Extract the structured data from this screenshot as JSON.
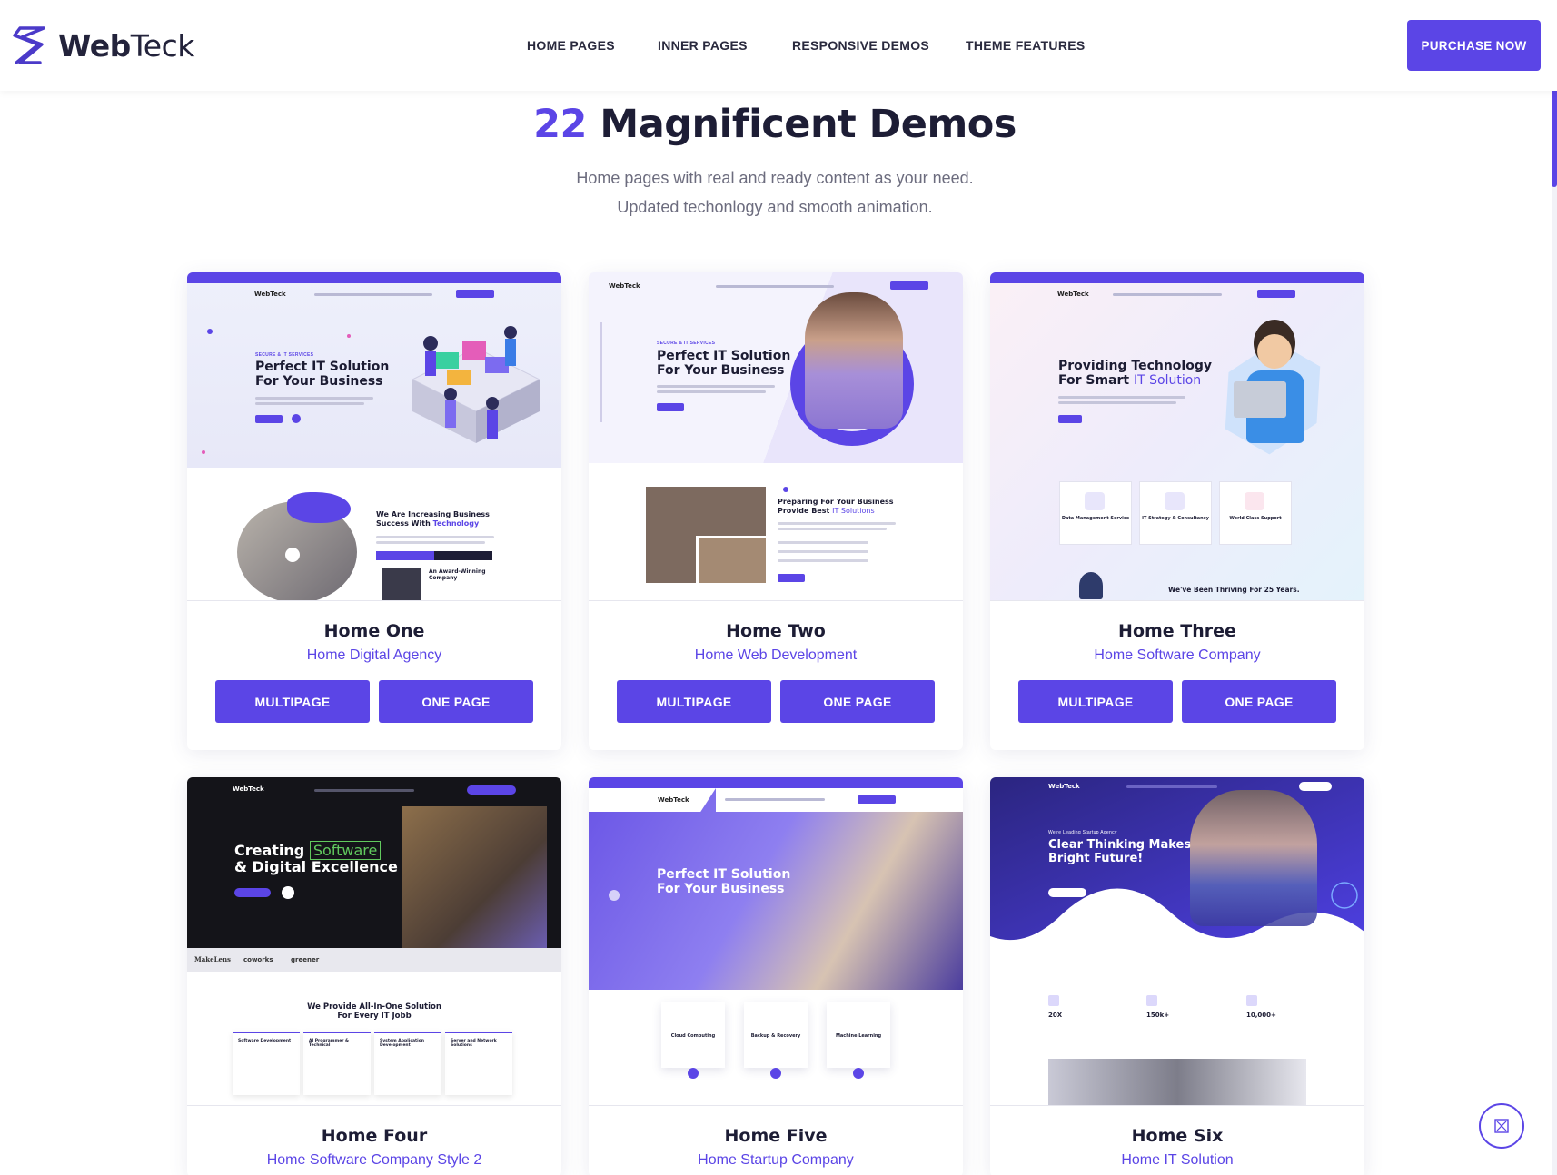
{
  "brand": {
    "name_bold": "Web",
    "name_regular": "Teck"
  },
  "nav": {
    "items": [
      "HOME PAGES",
      "INNER PAGES",
      "RESPONSIVE DEMOS",
      "THEME FEATURES"
    ],
    "purchase_label": "PURCHASE NOW"
  },
  "hero": {
    "count": "22",
    "title": "Magnificent Demos",
    "line1": "Home pages with real and ready content as your need.",
    "line2": "Updated techonlogy and smooth animation."
  },
  "colors": {
    "accent": "#5b45e6",
    "heading": "#1d1d35",
    "muted": "#6c6c7e"
  },
  "demos": [
    {
      "title": "Home One",
      "subtitle": "Home Digital Agency",
      "buttons": [
        "MULTIPAGE",
        "ONE PAGE"
      ],
      "preview": {
        "eyebrow": "SECURE & IT SERVICES",
        "heading_1": "Perfect IT Solution",
        "heading_2": "For Your Business",
        "section_1": "We Are Increasing Business",
        "section_2": "Success With",
        "section_3": "Technology",
        "award_1": "An Award-Winning",
        "award_2": "Company"
      }
    },
    {
      "title": "Home Two",
      "subtitle": "Home Web Development",
      "buttons": [
        "MULTIPAGE",
        "ONE PAGE"
      ],
      "preview": {
        "eyebrow": "SECURE & IT SERVICES",
        "heading_1": "Perfect IT Solution",
        "heading_2": "For Your Business",
        "section_1": "Preparing For Your Business",
        "section_2": "Provide Best",
        "section_3": "IT Solutions"
      }
    },
    {
      "title": "Home Three",
      "subtitle": "Home Software Company",
      "buttons": [
        "MULTIPAGE",
        "ONE PAGE"
      ],
      "preview": {
        "heading_1": "Providing Technology",
        "heading_2": "For Smart",
        "heading_3": "IT Solution",
        "service_1": "Data Management Service",
        "service_2": "IT Strategy & Consultancy",
        "service_3": "World Class Support",
        "bottom": "We've Been Thriving For 25 Years."
      }
    },
    {
      "title": "Home Four",
      "subtitle": "Home Software Company Style 2",
      "buttons": [],
      "preview": {
        "heading_1": "Creating",
        "heading_2": "Software",
        "heading_3": "& Digital Excellence",
        "logos": [
          "MakeLens",
          "coworks",
          "greener"
        ],
        "section_1": "We Provide All-In-One Solution",
        "section_2": "For Every IT Jobb",
        "cols": [
          "Software Development",
          "AI Programmer & Technical",
          "System Application Development",
          "Server and Network Solutions"
        ]
      }
    },
    {
      "title": "Home Five",
      "subtitle": "Home Startup Company",
      "buttons": [],
      "preview": {
        "heading_1": "Perfect IT Solution",
        "heading_2": "For Your Business",
        "services": [
          "Cloud Computing",
          "Backup & Recovery",
          "Machine Learning"
        ]
      }
    },
    {
      "title": "Home Six",
      "subtitle": "Home IT Solution",
      "buttons": [],
      "preview": {
        "eyebrow": "We're Leading Startup Agency",
        "heading_1": "Clear Thinking Makes",
        "heading_2": "Bright Future!",
        "stats": [
          "20X",
          "150k+",
          "10,000+"
        ]
      }
    }
  ]
}
